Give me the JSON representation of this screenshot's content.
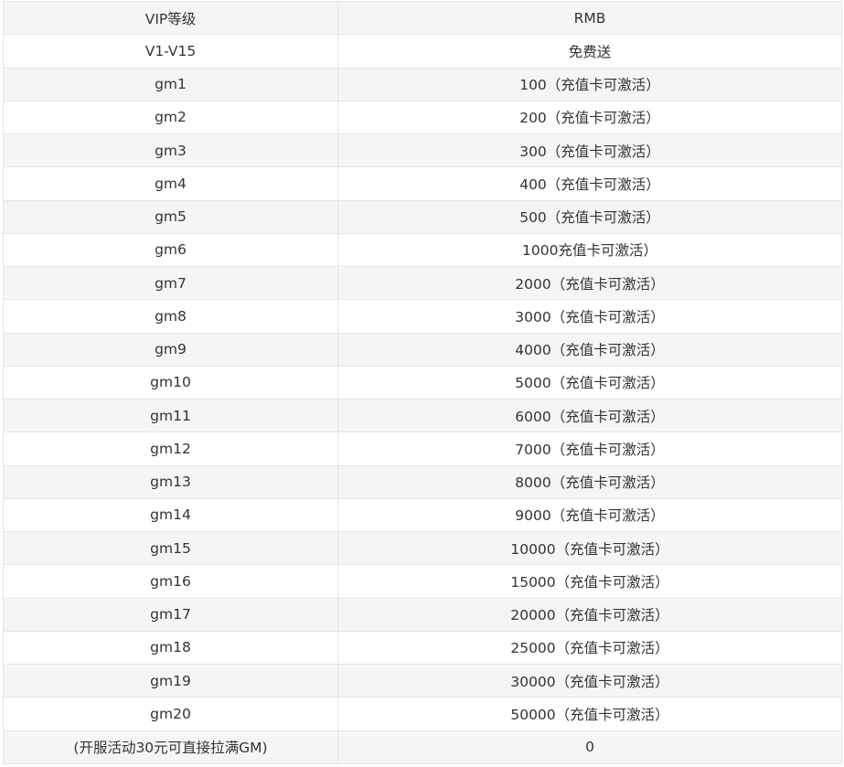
{
  "table": {
    "headers": [
      "VIP等级",
      "RMB"
    ],
    "rows": [
      [
        "V1-V15",
        "免费送"
      ],
      [
        "gm1",
        "100（充值卡可激活）"
      ],
      [
        "gm2",
        "200（充值卡可激活）"
      ],
      [
        "gm3",
        "300（充值卡可激活）"
      ],
      [
        "gm4",
        "400（充值卡可激活）"
      ],
      [
        "gm5",
        "500（充值卡可激活）"
      ],
      [
        "gm6",
        "1000充值卡可激活）"
      ],
      [
        "gm7",
        "2000（充值卡可激活）"
      ],
      [
        "gm8",
        "3000（充值卡可激活）"
      ],
      [
        "gm9",
        "4000（充值卡可激活）"
      ],
      [
        "gm10",
        "5000（充值卡可激活）"
      ],
      [
        "gm11",
        "6000（充值卡可激活）"
      ],
      [
        "gm12",
        "7000（充值卡可激活）"
      ],
      [
        "gm13",
        "8000（充值卡可激活）"
      ],
      [
        "gm14",
        "9000（充值卡可激活）"
      ],
      [
        "gm15",
        "10000（充值卡可激活）"
      ],
      [
        "gm16",
        "15000（充值卡可激活）"
      ],
      [
        "gm17",
        "20000（充值卡可激活）"
      ],
      [
        "gm18",
        "25000（充值卡可激活）"
      ],
      [
        "gm19",
        "30000（充值卡可激活）"
      ],
      [
        "gm20",
        "50000（充值卡可激活）"
      ],
      [
        "(开服活动30元可直接拉满GM)",
        "0"
      ]
    ]
  }
}
